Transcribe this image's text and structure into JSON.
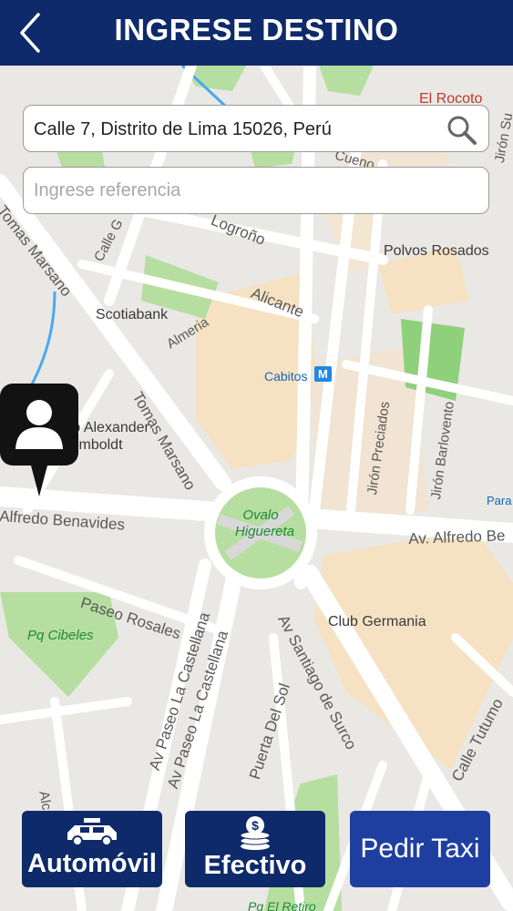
{
  "header": {
    "title": "INGRESE DESTINO",
    "back_icon": "chevron-left-icon"
  },
  "search": {
    "value": "Calle 7, Distrito de Lima 15026, Perú",
    "icon": "search-icon"
  },
  "reference": {
    "placeholder": "Ingrese referencia",
    "value": ""
  },
  "map": {
    "streets": [
      "Tomas Marsano",
      "Tomas Marsano",
      "Calle G",
      "Logroño",
      "Alicante",
      "Almeria",
      "Alfredo Benavides",
      "Av. Alfredo Be",
      "Paseo Rosales",
      "Av Paseo La Castellana",
      "Av Paseo La Castellana",
      "Av Santiago de Surco",
      "Puerta Del Sol",
      "Calle Tutumo",
      "Jirón Preciados",
      "Jirón Barlovento",
      "Alcala",
      "Cueno",
      "Jirón Su"
    ],
    "pois": [
      "El Rocoto",
      "Polvos Rosados",
      "Scotiabank",
      "Cabitos",
      "Colegio Alexander Von Humboldt",
      "Club Germania",
      "Para"
    ],
    "parks": [
      "Ovalo Higuereta",
      "Pq Cibeles",
      "Pq El Retiro"
    ],
    "metro_badge": "M",
    "marker_icon": "driver-person-icon",
    "colors": {
      "road": "#ffffff",
      "park": "#b6dea0",
      "park_dark": "#8fd07a",
      "building": "#f6e2c2",
      "block": "#e9e8e4",
      "water": "#4aa8f0"
    }
  },
  "buttons": {
    "vehicle": {
      "label": "Automóvil",
      "icon": "taxi-car-icon"
    },
    "payment": {
      "label": "Efectivo",
      "icon": "cash-coins-icon"
    },
    "order": {
      "label": "Pedir Taxi"
    }
  },
  "colors": {
    "header": "#0e2a6a",
    "button": "#0e2a6a",
    "order_button": "#1f3fa0"
  }
}
